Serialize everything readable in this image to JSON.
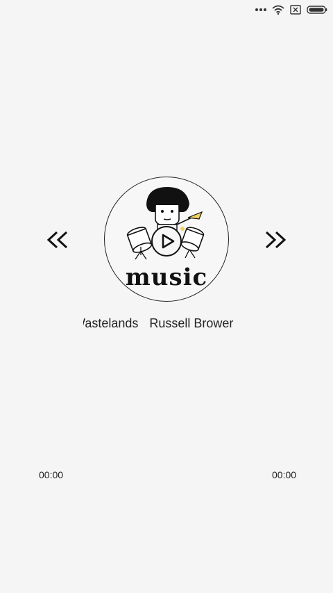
{
  "status_bar": {
    "icons": [
      "more-dots-icon",
      "wifi-icon",
      "sim-off-icon",
      "battery-icon"
    ]
  },
  "player": {
    "prev_icon": "double-chevron-left-icon",
    "next_icon": "double-chevron-right-icon",
    "cover_text": "music",
    "play_icon": "play-icon"
  },
  "track": {
    "title": "Wastelands",
    "artist": "Russell Brower"
  },
  "progress": {
    "elapsed": "00:00",
    "total": "00:00",
    "fraction": 0
  },
  "colors": {
    "background": "#f5f5f5",
    "foreground": "#222222"
  }
}
